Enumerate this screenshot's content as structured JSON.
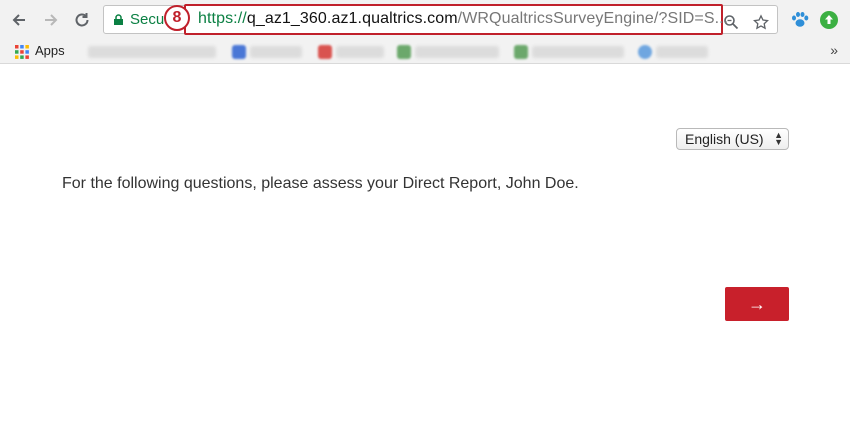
{
  "browser": {
    "secure_label": "Secu",
    "url_scheme": "https://",
    "url_host": "q_az1_360.az1.qualtrics.com",
    "url_path": "/WRQualtricsSurveyEngine/?SID=S...",
    "step_number": "8",
    "step_color": "#c0202b"
  },
  "bookmarks": {
    "apps_label": "Apps",
    "more_label": "»"
  },
  "survey": {
    "language": "English (US)",
    "question_text": "For the following questions, please assess your Direct Report, John Doe.",
    "next_label": "→",
    "accent_color": "#c8202b"
  }
}
